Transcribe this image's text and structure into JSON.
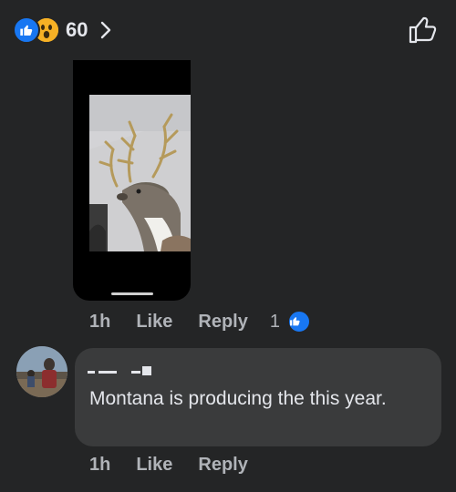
{
  "reactions": {
    "count": "60",
    "types": [
      "like",
      "wow"
    ]
  },
  "icons": {
    "like_reaction": "thumbs-up-filled-icon",
    "wow_reaction": "wow-face-icon",
    "chevron": "chevron-right-icon",
    "like_outline": "thumbs-up-outline-icon"
  },
  "colors": {
    "background": "#242526",
    "bubble": "#3a3b3c",
    "like_blue": "#1877f2",
    "wow_yellow": "#f7b125",
    "meta_gray": "#b0b3b8"
  },
  "comments": [
    {
      "type": "image",
      "time": "1h",
      "like_label": "Like",
      "reply_label": "Reply",
      "reaction_count": "1"
    },
    {
      "type": "text",
      "author": "",
      "text": "Montana is producing the this year.",
      "time": "1h",
      "like_label": "Like",
      "reply_label": "Reply"
    }
  ]
}
